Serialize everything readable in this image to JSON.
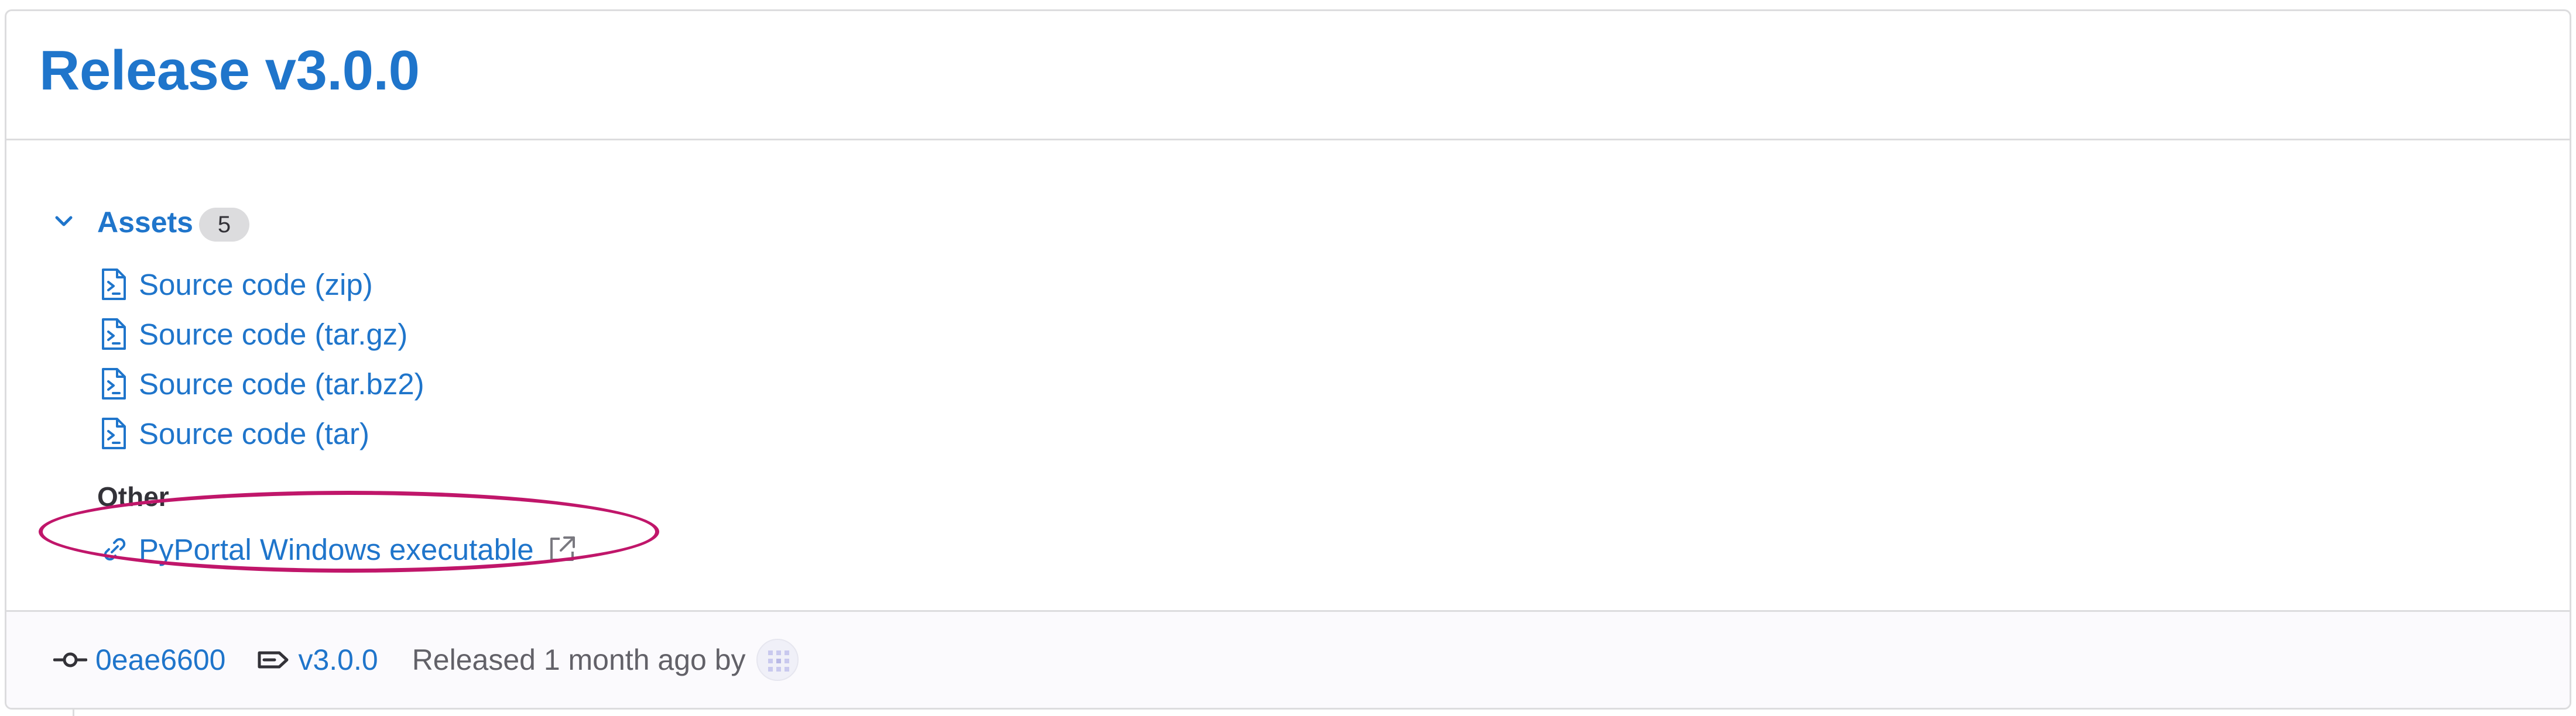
{
  "release": {
    "title": "Release v3.0.0"
  },
  "assets": {
    "label": "Assets",
    "count": "5",
    "source_links": [
      {
        "label": "Source code (zip)"
      },
      {
        "label": "Source code (tar.gz)"
      },
      {
        "label": "Source code (tar.bz2)"
      },
      {
        "label": "Source code (tar)"
      }
    ],
    "other_heading": "Other",
    "other_links": [
      {
        "label": "PyPortal Windows executable"
      }
    ]
  },
  "footer": {
    "commit": "0eae6600",
    "tag": "v3.0.0",
    "released_text": "Released 1 month ago by"
  },
  "colors": {
    "link": "#1f75cb",
    "border": "#dcdcde",
    "annotation": "#c0166a",
    "footer_bg": "#fbfafd"
  },
  "icons": [
    "chevron-down-icon",
    "file-code-icon",
    "link-icon",
    "external-link-icon",
    "commit-icon",
    "tag-icon",
    "avatar"
  ]
}
